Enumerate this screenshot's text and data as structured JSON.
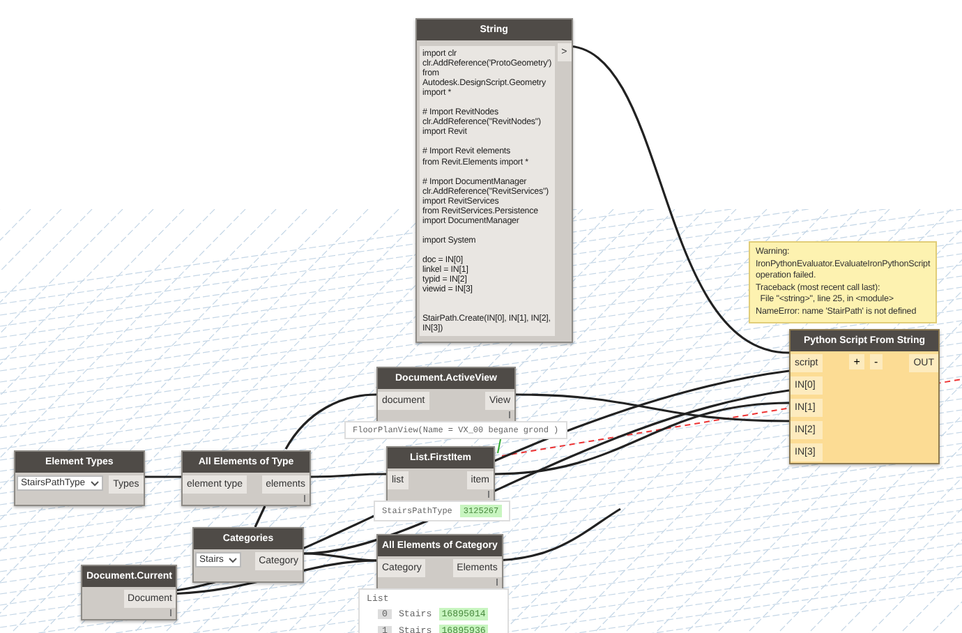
{
  "nodes": [
    {
      "kind": "code",
      "title": "String",
      "code": "import clr\nclr.AddReference('ProtoGeometry')\nfrom\nAutodesk.DesignScript.Geometry\nimport *\n\n# Import RevitNodes\nclr.AddReference(\"RevitNodes\")\nimport Revit\n\n# Import Revit elements\nfrom Revit.Elements import *\n\n# Import DocumentManager\nclr.AddReference(\"RevitServices\")\nimport RevitServices\nfrom RevitServices.Persistence\nimport DocumentManager\n\nimport System\n\ndoc = IN[0]\nlinkel = IN[1]\ntypid = IN[2]\nviewid = IN[3]\n\n\nStairPath.Create(IN[0], IN[1], IN[2],\nIN[3])",
      "outputs": [
        ">"
      ]
    },
    {
      "kind": "python",
      "title": "Python Script From String",
      "warning": "Warning:\nIronPythonEvaluator.EvaluateIronPythonScript\noperation failed.\nTraceback (most recent call last):\n  File \"<string>\", line 25, in <module>\nNameError: name 'StairPath' is not defined",
      "inputs": [
        "script",
        "IN[0]",
        "IN[1]",
        "IN[2]",
        "IN[3]"
      ],
      "buttons": [
        "+",
        "-"
      ],
      "outputs": [
        "OUT"
      ]
    },
    {
      "kind": "normal",
      "title": "Document.ActiveView",
      "inputs": [
        "document"
      ],
      "outputs": [
        "View"
      ],
      "preview": "FloorPlanView(Name = VX_00 begane grond )"
    },
    {
      "kind": "dropdown",
      "title": "Element Types",
      "value": "StairsPathType",
      "outputs": [
        "Types"
      ]
    },
    {
      "kind": "normal",
      "title": "All Elements of Type",
      "inputs": [
        "element type"
      ],
      "outputs": [
        "elements"
      ]
    },
    {
      "kind": "normal",
      "title": "List.FirstItem",
      "inputs": [
        "list"
      ],
      "outputs": [
        "item"
      ],
      "preview": "StairsPathType",
      "preview_value": "3125267"
    },
    {
      "kind": "normal",
      "title": "Document.Current",
      "outputs": [
        "Document"
      ]
    },
    {
      "kind": "dropdown",
      "title": "Categories",
      "value": "Stairs",
      "outputs": [
        "Category"
      ]
    },
    {
      "kind": "normal",
      "title": "All Elements of Category",
      "inputs": [
        "Category"
      ],
      "outputs": [
        "Elements"
      ],
      "list_preview": {
        "title": "List",
        "items": [
          {
            "index": "0",
            "label": "Stairs",
            "value": "16895014"
          },
          {
            "index": "1",
            "label": "Stairs",
            "value": "16895936"
          }
        ]
      }
    }
  ]
}
